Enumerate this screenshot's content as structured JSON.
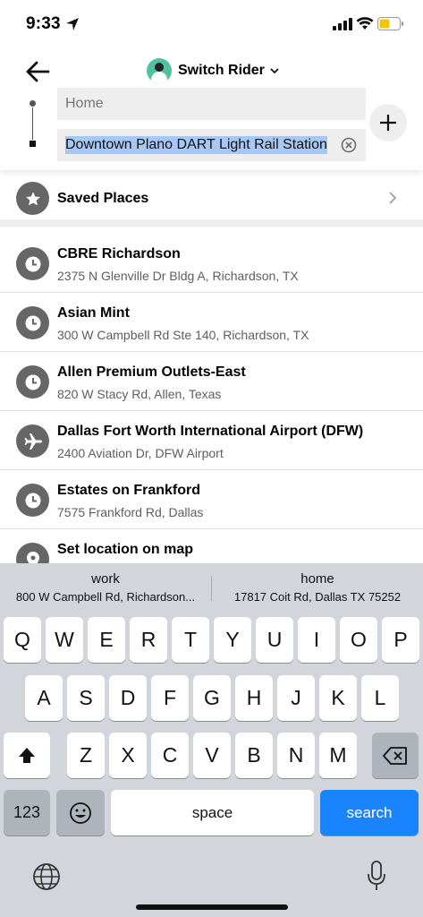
{
  "status_bar": {
    "time": "9:33"
  },
  "header": {
    "rider_label": "Switch Rider",
    "pickup": {
      "placeholder": "Home"
    },
    "destination": {
      "value": "Downtown Plano DART Light Rail Station"
    }
  },
  "saved_places": {
    "label": "Saved Places"
  },
  "recent": [
    {
      "title": "CBRE Richardson",
      "address": "2375 N Glenville Dr Bldg A, Richardson, TX",
      "icon": "clock-icon"
    },
    {
      "title": "Asian Mint",
      "address": "300 W Campbell Rd Ste 140, Richardson, TX",
      "icon": "clock-icon"
    },
    {
      "title": "Allen Premium Outlets-East",
      "address": "820 W Stacy Rd, Allen, Texas",
      "icon": "clock-icon"
    },
    {
      "title": "Dallas Fort Worth International Airport (DFW)",
      "address": "2400 Aviation Dr, DFW Airport",
      "icon": "airplane-icon"
    },
    {
      "title": "Estates on Frankford",
      "address": "7575 Frankford Rd, Dallas",
      "icon": "clock-icon"
    },
    {
      "title": "Set location on map",
      "address": "",
      "icon": "pin-icon"
    }
  ],
  "keyboard": {
    "suggestions": [
      {
        "title": "work",
        "subtitle": "800 W Campbell Rd, Richardson..."
      },
      {
        "title": "home",
        "subtitle": "17817 Coit Rd, Dallas TX 75252"
      }
    ],
    "row1": [
      "Q",
      "W",
      "E",
      "R",
      "T",
      "Y",
      "U",
      "I",
      "O",
      "P"
    ],
    "row2": [
      "A",
      "S",
      "D",
      "F",
      "G",
      "H",
      "J",
      "K",
      "L"
    ],
    "row3": [
      "Z",
      "X",
      "C",
      "V",
      "B",
      "N",
      "M"
    ],
    "numbers_label": "123",
    "space_label": "space",
    "search_label": "search"
  },
  "colors": {
    "accent": "#1a84ff",
    "selection": "#a7c8f5"
  }
}
